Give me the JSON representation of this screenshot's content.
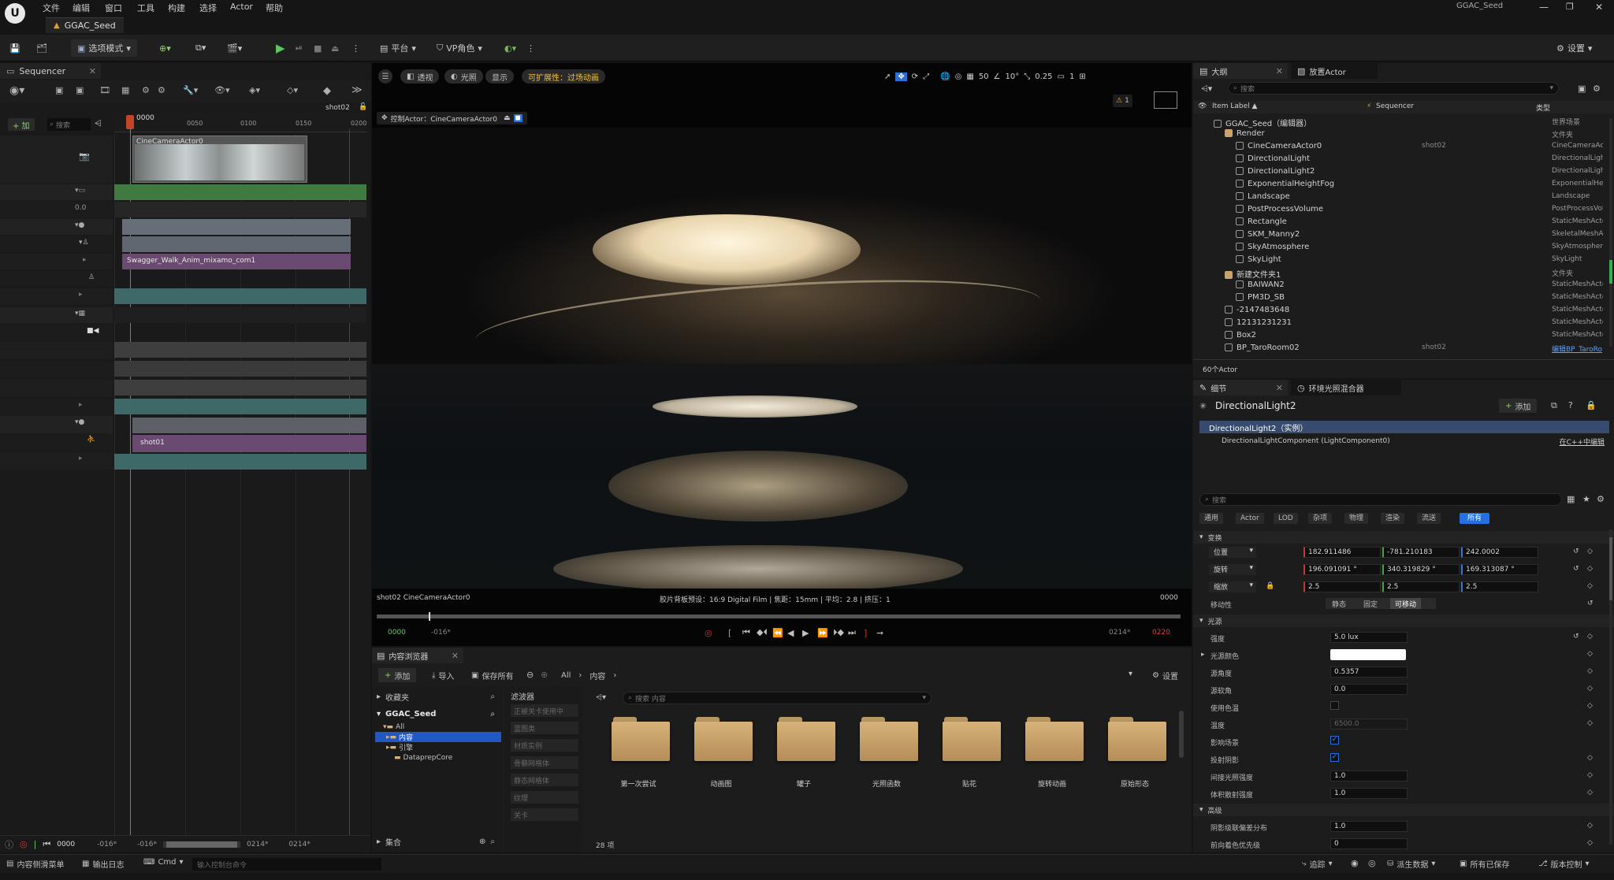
{
  "menu": [
    "文件",
    "编辑",
    "窗口",
    "工具",
    "构建",
    "选择",
    "Actor",
    "帮助"
  ],
  "window_title": "GGAC_Seed",
  "tab_title": "GGAC_Seed",
  "toolbar": {
    "mode": "选项模式",
    "platform": "平台",
    "vp_role": "VP角色",
    "settings": "设置"
  },
  "sequencer": {
    "tab": "Sequencer",
    "shot_label": "shot02",
    "add": "+ 加",
    "search_placeholder": "搜索",
    "time_start": "0000",
    "ruler_ticks": [
      "0050",
      "0100",
      "0150",
      "0200"
    ],
    "camera_clip": "CineCameraActor0",
    "value_00": "0.0",
    "anim_clip": "Swagger_Walk_Anim_mixamo_com1",
    "shot_clip": "shot01",
    "bottom_time": "0000",
    "bottom_range": [
      "-016*",
      "-016*",
      "0214*",
      "0214*"
    ]
  },
  "viewport": {
    "menu_btn": "☰",
    "perspective": "透视",
    "lit": "光照",
    "show": "显示",
    "scalability": "可扩展性：过场动画",
    "pilot": "控制Actor：CineCameraActor0",
    "grid_size": "50",
    "rot_snap": "10°",
    "scale_snap": "0.25",
    "cam_speed": "1",
    "warning_count": "1",
    "shot_camera": "shot02 CineCameraActor0",
    "film_info": "胶片背板预设：16:9 Digital Film | 焦距：15mm | 平均：2.8 | 挤压：1",
    "frame_right": "0000",
    "play_left_green": "0000",
    "play_left_range": "-016*",
    "play_right_range": "0214*",
    "play_right_red": "0220"
  },
  "content_browser": {
    "tab": "内容浏览器",
    "add": "添加",
    "import": "导入",
    "save_all": "保存所有",
    "path": [
      "All",
      "内容"
    ],
    "settings": "设置",
    "favorites": "收藏夹",
    "project": "GGAC_Seed",
    "tree": [
      "All",
      "内容",
      "引擎",
      "DataprepCore"
    ],
    "filters_title": "滤波器",
    "filters": [
      "正被关卡使用中",
      "蓝图类",
      "材质实例",
      "骨骼网格体",
      "静态网格体",
      "纹理",
      "关卡"
    ],
    "search_placeholder": "搜索 内容",
    "folders": [
      "第一次尝试",
      "动画图",
      "罐子",
      "光照函数",
      "贴花",
      "旋转动画",
      "原始形态"
    ],
    "collections": "集合",
    "item_count": "28 项"
  },
  "outliner": {
    "tab": "大纲",
    "tab2": "放置Actor",
    "search_placeholder": "搜索",
    "col_label": "Item Label ▲",
    "col_seq": "Sequencer",
    "col_type": "类型",
    "rows": [
      {
        "indent": 0,
        "label": "GGAC_Seed（编辑器）",
        "seq": "",
        "type": "世界场景"
      },
      {
        "indent": 1,
        "label": "Render",
        "seq": "",
        "type": "文件夹"
      },
      {
        "indent": 2,
        "label": "CineCameraActor0",
        "seq": "shot02",
        "type": "CineCameraActor"
      },
      {
        "indent": 2,
        "label": "DirectionalLight",
        "seq": "",
        "type": "DirectionalLight"
      },
      {
        "indent": 2,
        "label": "DirectionalLight2",
        "seq": "",
        "type": "DirectionalLight"
      },
      {
        "indent": 2,
        "label": "ExponentialHeightFog",
        "seq": "",
        "type": "ExponentialHeig"
      },
      {
        "indent": 2,
        "label": "Landscape",
        "seq": "",
        "type": "Landscape"
      },
      {
        "indent": 2,
        "label": "PostProcessVolume",
        "seq": "",
        "type": "PostProcessVolu"
      },
      {
        "indent": 2,
        "label": "Rectangle",
        "seq": "",
        "type": "StaticMeshActo"
      },
      {
        "indent": 2,
        "label": "SKM_Manny2",
        "seq": "",
        "type": "SkeletalMeshAc"
      },
      {
        "indent": 2,
        "label": "SkyAtmosphere",
        "seq": "",
        "type": "SkyAtmosphere"
      },
      {
        "indent": 2,
        "label": "SkyLight",
        "seq": "",
        "type": "SkyLight"
      },
      {
        "indent": 1,
        "label": "新建文件夹1",
        "seq": "",
        "type": "文件夹"
      },
      {
        "indent": 2,
        "label": "BAIWAN2",
        "seq": "",
        "type": "StaticMeshActo"
      },
      {
        "indent": 2,
        "label": "PM3D_SB",
        "seq": "",
        "type": "StaticMeshActo"
      },
      {
        "indent": 1,
        "label": "-2147483648",
        "seq": "",
        "type": "StaticMeshActo"
      },
      {
        "indent": 1,
        "label": "12131231231",
        "seq": "",
        "type": "StaticMeshActo"
      },
      {
        "indent": 1,
        "label": "Box2",
        "seq": "",
        "type": "StaticMeshActo"
      },
      {
        "indent": 1,
        "label": "BP_TaroRoom02",
        "seq": "shot02",
        "type": "编辑BP_TaroRo"
      }
    ],
    "actor_count": "60个Actor"
  },
  "details": {
    "tab": "细节",
    "tab2": "环境光照混合器",
    "object_name": "DirectionalLight2",
    "add": "添加",
    "instance": "DirectionalLight2（实例）",
    "component": "DirectionalLightComponent (LightComponent0)",
    "edit_cpp": "在C++中编辑",
    "search_placeholder": "搜索",
    "filter_tabs": [
      "通用",
      "Actor",
      "LOD",
      "杂项",
      "物理",
      "渲染",
      "流送",
      "所有"
    ],
    "transform_header": "变换",
    "location_label": "位置",
    "location": [
      "182.911486",
      "-781.210183",
      "242.0002"
    ],
    "rotation_label": "旋转",
    "rotation": [
      "196.091091 °",
      "340.319829 °",
      "169.313087 °"
    ],
    "scale_label": "缩放",
    "scale": [
      "2.5",
      "2.5",
      "2.5"
    ],
    "mobility_label": "移动性",
    "mobility": [
      "静态",
      "固定",
      "可移动"
    ],
    "light_header": "光源",
    "intensity_label": "强度",
    "intensity": "5.0 lux",
    "light_color_label": "光源颜色",
    "source_angle_label": "源角度",
    "source_angle": "0.5357",
    "source_soft_label": "源软角",
    "source_soft": "0.0",
    "use_temp_label": "使用色温",
    "temperature_label": "温度",
    "temperature": "6500.0",
    "affects_world_label": "影响场景",
    "cast_shadows_label": "投射阴影",
    "indirect_label": "间接光照强度",
    "indirect": "1.0",
    "volumetric_label": "体积散射强度",
    "volumetric": "1.0",
    "advanced_header": "高级",
    "shadow_cascade_label": "阴影级联偏差分布",
    "shadow_cascade": "1.0",
    "forward_priority_label": "前向着色优先级",
    "forward_priority": "0"
  },
  "statusbar": {
    "content_drawer": "内容侧滑菜单",
    "output_log": "输出日志",
    "cmd": "Cmd",
    "cmd_placeholder": "输入控制台命令",
    "trace": "追踪",
    "derived_data": "派生数据",
    "all_saved": "所有已保存",
    "source_control": "版本控制"
  }
}
